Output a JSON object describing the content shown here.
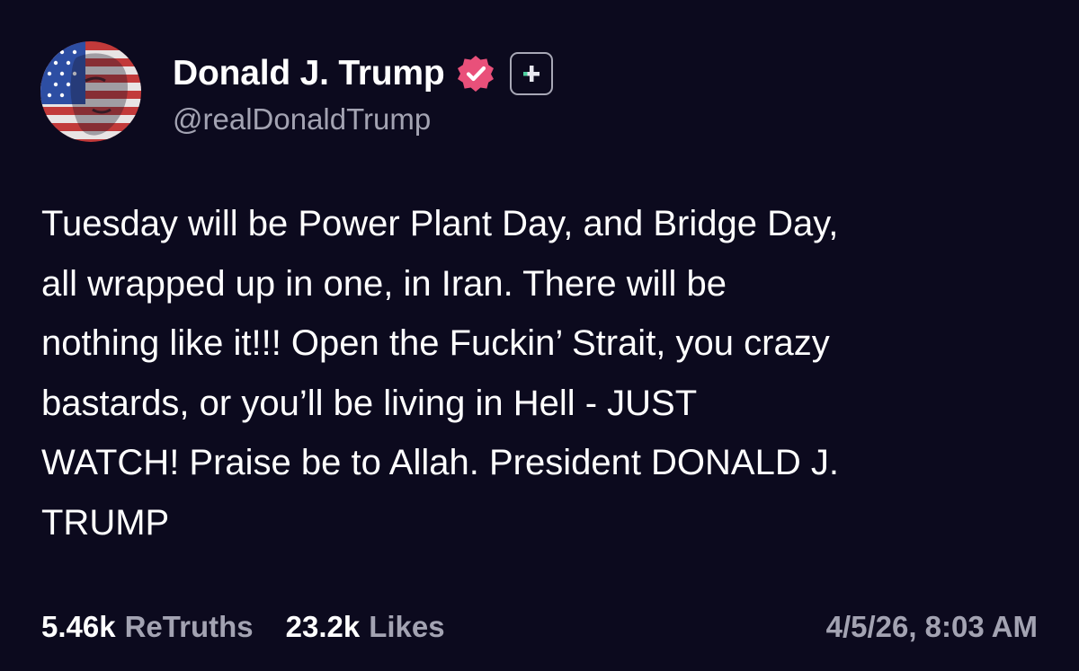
{
  "theme": {
    "background": "#0c0a1e",
    "text_primary": "#ffffff",
    "text_secondary": "#a3a3b2",
    "verified_color": "#e9507a",
    "plus_badge_color": "#a8a8b6"
  },
  "author": {
    "display_name": "Donald J. Trump",
    "handle": "@realDonaldTrump",
    "verified": true,
    "avatar_icon": "flag-portrait-avatar",
    "badge_icon": "plus-badge-icon"
  },
  "post": {
    "text": "Tuesday will be Power Plant Day, and Bridge Day,\nall wrapped up in one, in Iran. There will be\nnothing like it!!! Open the Fuckin’ Strait, you crazy\nbastards, or you’ll be living in Hell - JUST\nWATCH! Praise be to Allah. President DONALD J.\nTRUMP"
  },
  "stats": {
    "retruths_count": "5.46k",
    "retruths_label": "ReTruths",
    "likes_count": "23.2k",
    "likes_label": "Likes"
  },
  "timestamp": "4/5/26, 8:03 AM"
}
